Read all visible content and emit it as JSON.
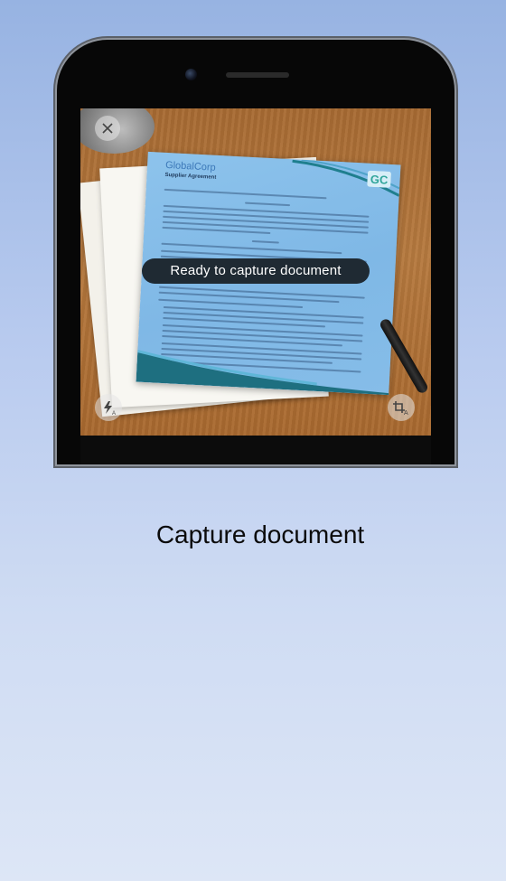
{
  "caption": "Capture document",
  "camera_view": {
    "status_text": "Ready to capture document",
    "document": {
      "company": "GlobalCorp",
      "doc_title": "Supplier Agreement",
      "logo_text": "GC"
    }
  },
  "controls": {
    "close_icon": "close-icon",
    "flash_icon": "flash-auto-icon",
    "crop_icon": "crop-text-icon"
  },
  "colors": {
    "overlay_blue": "#8dc3ec",
    "pill_bg": "#1f2a33",
    "logo_teal": "#2fa59a"
  }
}
